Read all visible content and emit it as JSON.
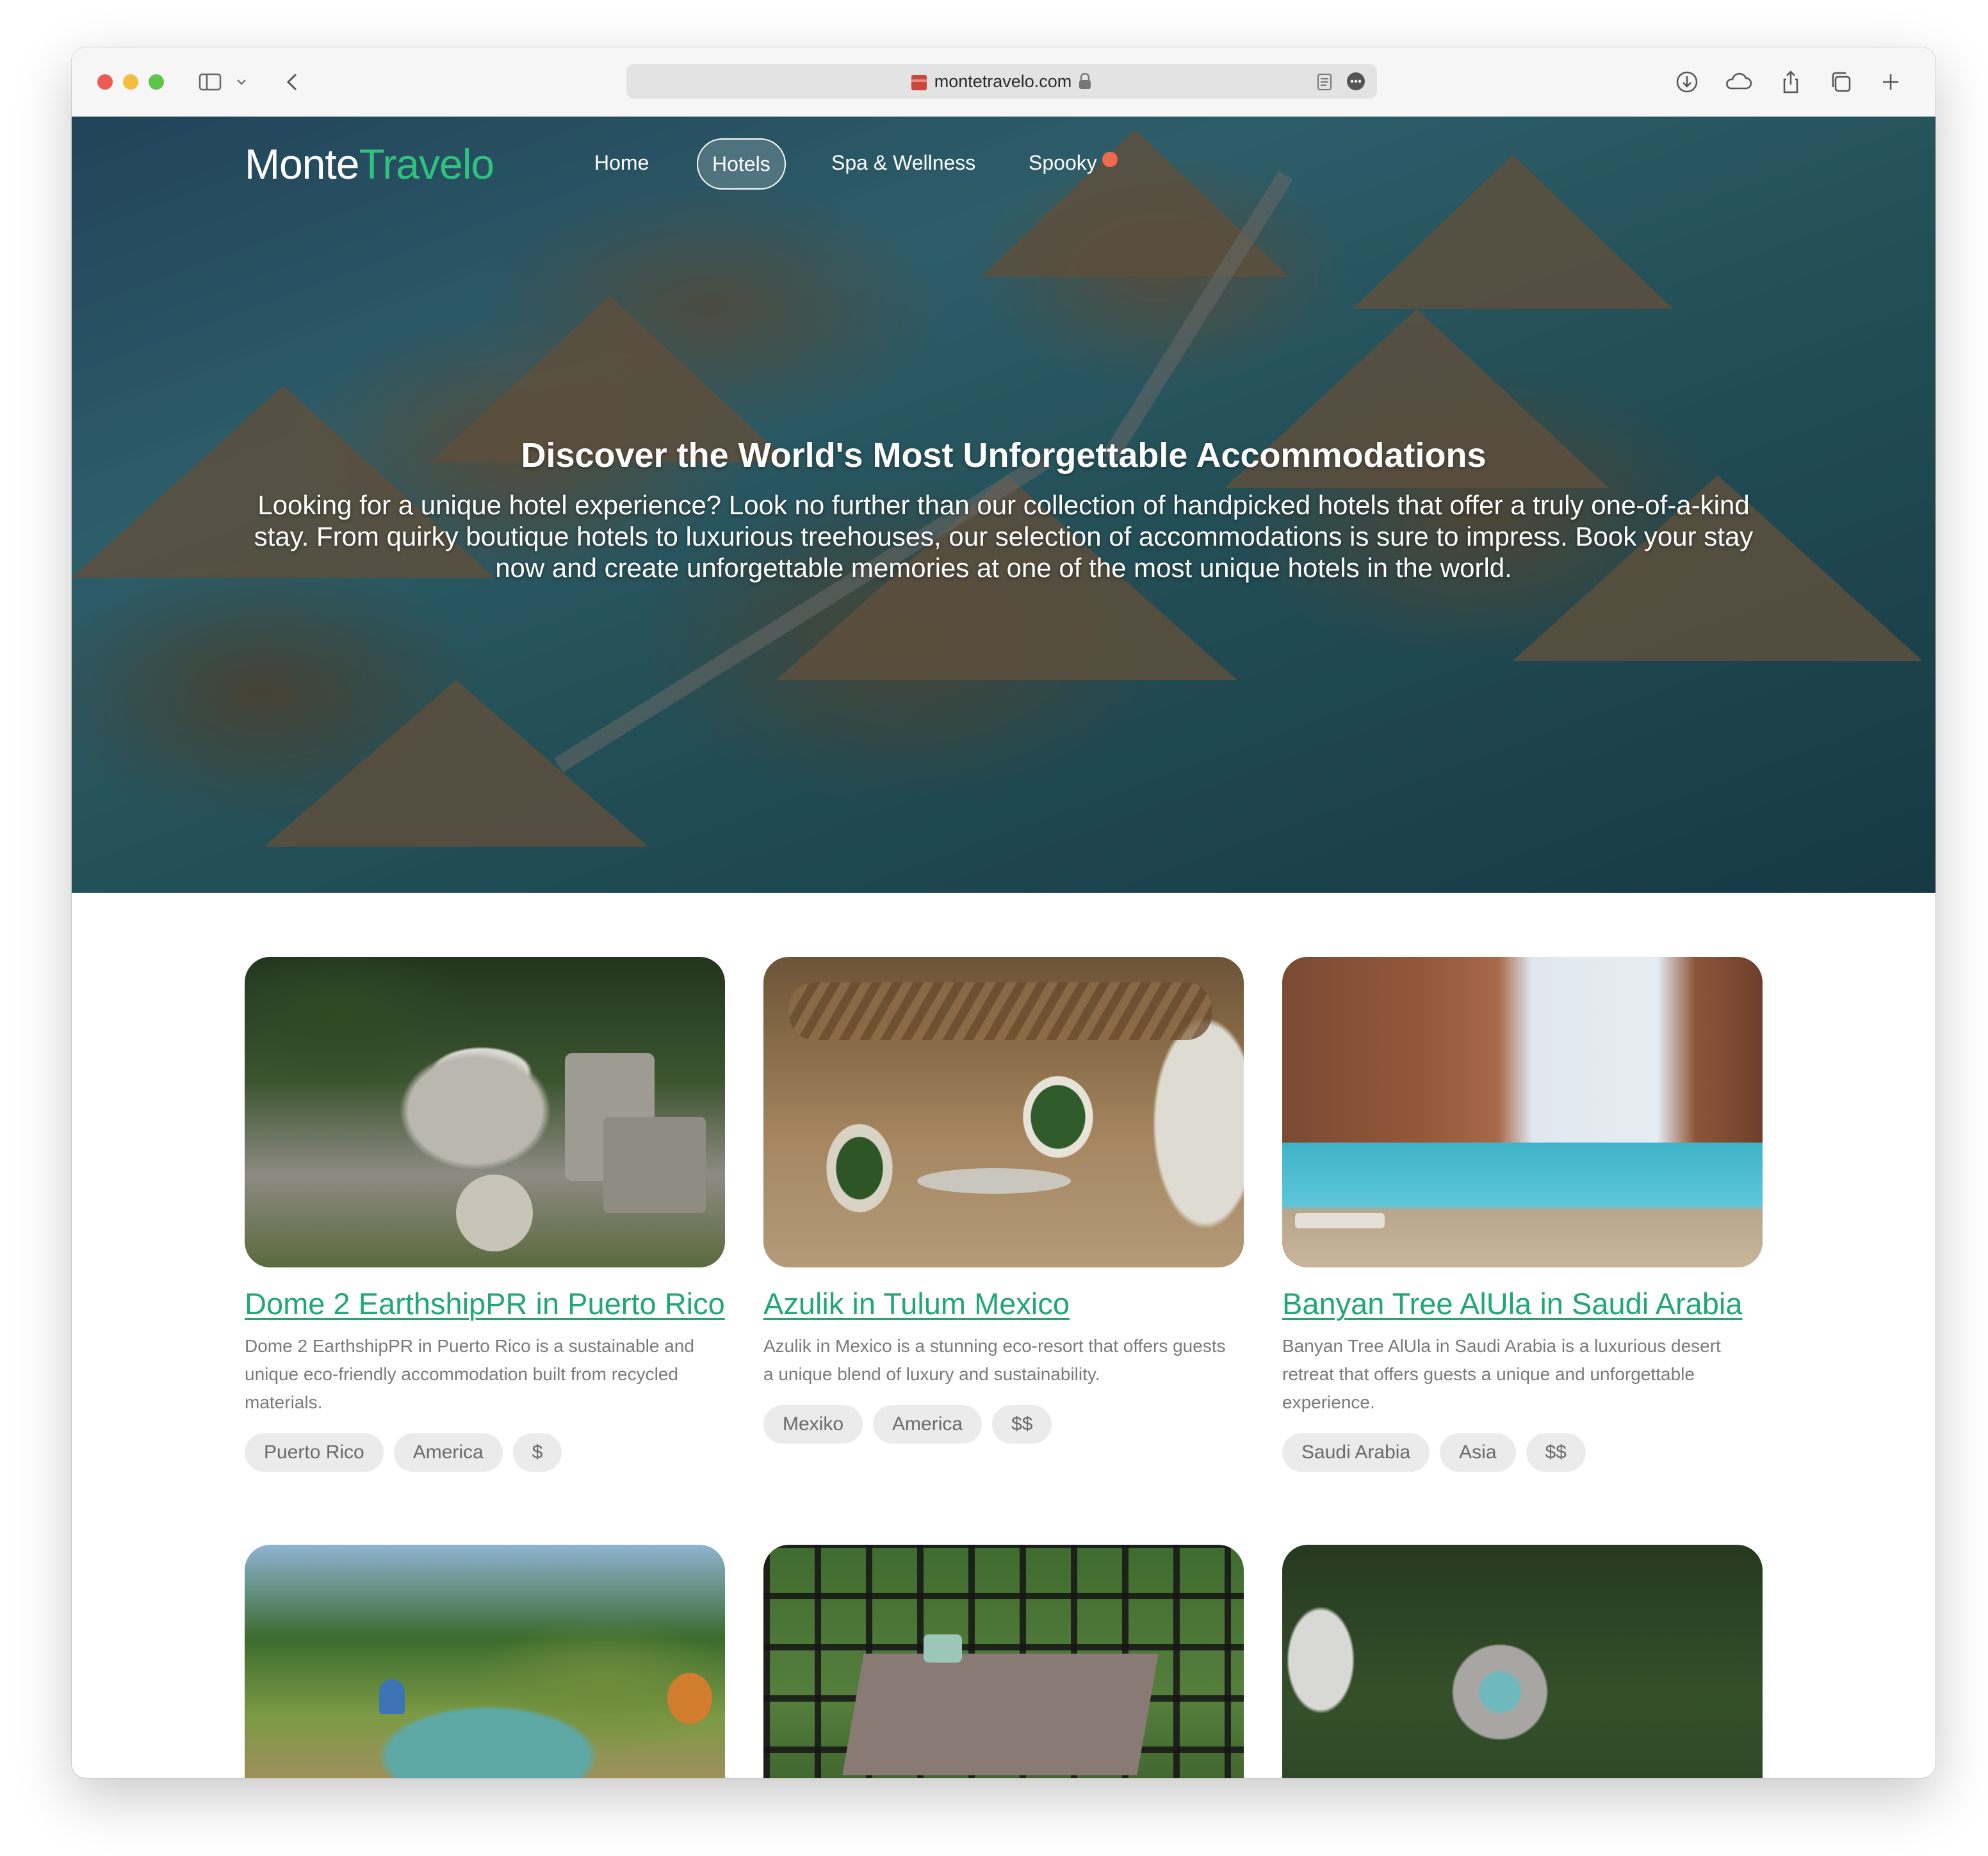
{
  "browser": {
    "url": "montetravelo.com"
  },
  "site": {
    "brand_part1": "Monte",
    "brand_part2": "Travelo",
    "nav": [
      {
        "label": "Home"
      },
      {
        "label": "Hotels",
        "active": true
      },
      {
        "label": "Spa & Wellness"
      },
      {
        "label": "Spooky"
      }
    ]
  },
  "hero": {
    "title": "Discover the World's Most Unforgettable Accommodations",
    "subtitle": "Looking for a unique hotel experience? Look no further than our collection of handpicked hotels that offer a truly one-of-a-kind stay. From quirky boutique hotels to luxurious treehouses, our selection of accommodations is sure to impress. Book your stay now and create unforgettable memories at one of the most unique hotels in the world."
  },
  "cards": [
    {
      "title": "Dome 2 EarthshipPR in Puerto Rico",
      "description": "Dome 2 EarthshipPR in Puerto Rico is a sustainable and unique eco-friendly accommodation built from recycled materials.",
      "tags": [
        "Puerto Rico",
        "America",
        "$"
      ]
    },
    {
      "title": "Azulik in Tulum Mexico",
      "description": "Azulik in Mexico is a stunning eco-resort that offers guests a unique blend of luxury and sustainability.",
      "tags": [
        "Mexiko",
        "America",
        "$$"
      ]
    },
    {
      "title": "Banyan Tree AlUla in Saudi Arabia",
      "description": "Banyan Tree AlUla in Saudi Arabia is a luxurious desert retreat that offers guests a unique and unforgettable experience.",
      "tags": [
        "Saudi Arabia",
        "Asia",
        "$$"
      ]
    }
  ],
  "colors": {
    "accent": "#20a773",
    "brand_green": "#2ec27e",
    "tag_bg": "#ebebeb"
  }
}
